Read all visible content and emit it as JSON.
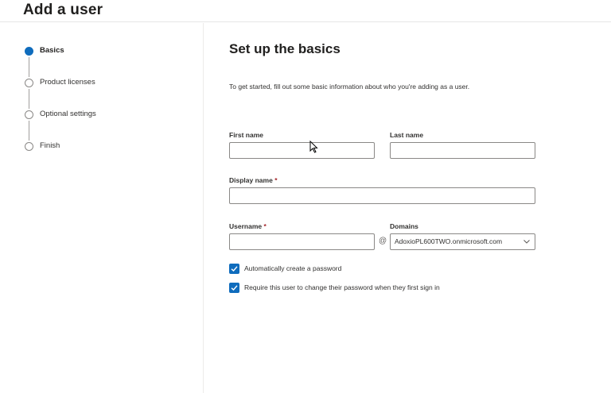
{
  "header": {
    "title": "Add a user"
  },
  "steps": [
    {
      "label": "Basics",
      "active": true
    },
    {
      "label": "Product licenses",
      "active": false
    },
    {
      "label": "Optional settings",
      "active": false
    },
    {
      "label": "Finish",
      "active": false
    }
  ],
  "main": {
    "heading": "Set up the basics",
    "intro": "To get started, fill out some basic information about who you're adding as a user."
  },
  "form": {
    "first_name_label": "First name",
    "first_name_value": "",
    "last_name_label": "Last name",
    "last_name_value": "",
    "display_name_label": "Display name",
    "display_name_value": "",
    "username_label": "Username",
    "username_value": "",
    "required_marker": "*",
    "at_symbol": "@",
    "domains_label": "Domains",
    "domains_selected": "AdoxioPL600TWO.onmicrosoft.com"
  },
  "options": {
    "auto_password_label": "Automatically create a password",
    "auto_password_checked": true,
    "require_change_label": "Require this user to change their password when they first sign in",
    "require_change_checked": true
  },
  "colors": {
    "accent": "#0f6cbd",
    "required": "#a4262c",
    "border": "#8a8886"
  },
  "icons": {
    "check": "checkmark-icon",
    "dropdown": "chevron-down-icon",
    "cursor": "mouse-pointer-icon"
  }
}
